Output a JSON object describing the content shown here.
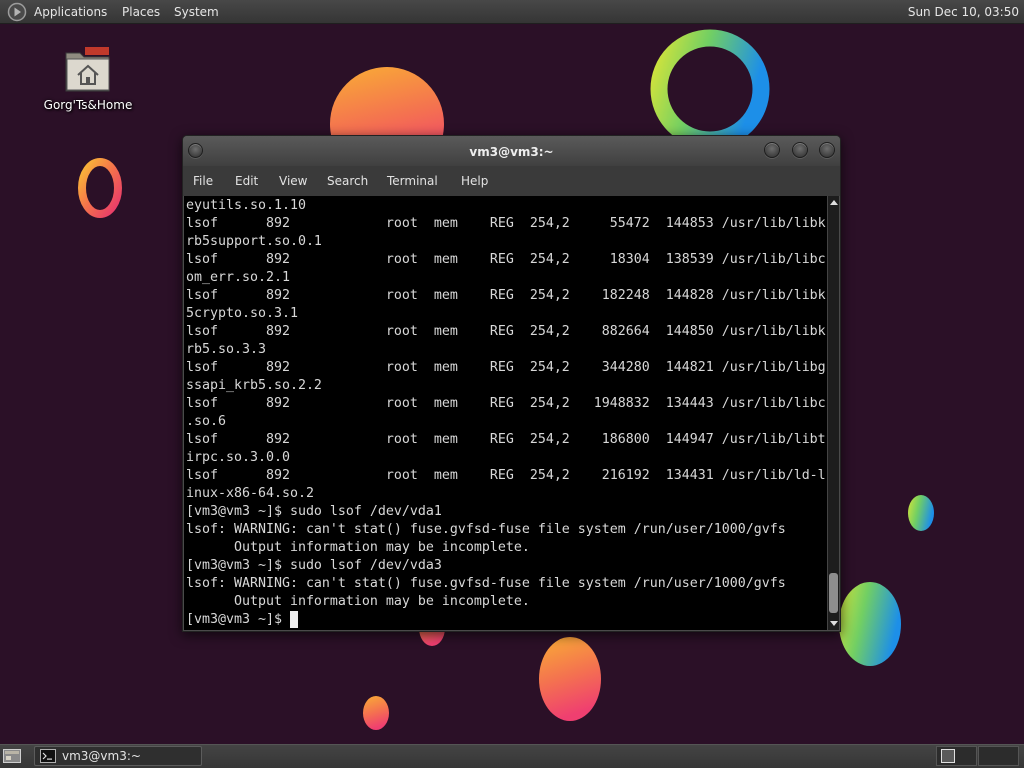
{
  "top_panel": {
    "logo_icon": "menu-logo-icon",
    "menus": {
      "applications": "Applications",
      "places": "Places",
      "system": "System"
    },
    "clock": "Sun Dec 10, 03:50"
  },
  "desktop": {
    "icon": {
      "label": "Gorg'Ts&Home",
      "icon": "home-folder-icon"
    }
  },
  "terminal": {
    "title": "vm3@vm3:~",
    "menu": [
      "File",
      "Edit",
      "View",
      "Search",
      "Terminal",
      "Help"
    ],
    "lines": [
      "eyutils.so.1.10",
      "lsof      892            root  mem    REG  254,2     55472  144853 /usr/lib/libk",
      "rb5support.so.0.1",
      "lsof      892            root  mem    REG  254,2     18304  138539 /usr/lib/libc",
      "om_err.so.2.1",
      "lsof      892            root  mem    REG  254,2    182248  144828 /usr/lib/libk",
      "5crypto.so.3.1",
      "lsof      892            root  mem    REG  254,2    882664  144850 /usr/lib/libk",
      "rb5.so.3.3",
      "lsof      892            root  mem    REG  254,2    344280  144821 /usr/lib/libg",
      "ssapi_krb5.so.2.2",
      "lsof      892            root  mem    REG  254,2   1948832  134443 /usr/lib/libc",
      ".so.6",
      "lsof      892            root  mem    REG  254,2    186800  144947 /usr/lib/libt",
      "irpc.so.3.0.0",
      "lsof      892            root  mem    REG  254,2    216192  134431 /usr/lib/ld-l",
      "inux-x86-64.so.2",
      "[vm3@vm3 ~]$ sudo lsof /dev/vda1",
      "lsof: WARNING: can't stat() fuse.gvfsd-fuse file system /run/user/1000/gvfs",
      "      Output information may be incomplete.",
      "[vm3@vm3 ~]$ sudo lsof /dev/vda3",
      "lsof: WARNING: can't stat() fuse.gvfsd-fuse file system /run/user/1000/gvfs",
      "      Output information may be incomplete."
    ],
    "prompt": "[vm3@vm3 ~]$ "
  },
  "bottom_panel": {
    "show_desktop_icon": "show-desktop-icon",
    "task": {
      "label": "vm3@vm3:~",
      "icon": "terminal-icon"
    }
  },
  "colors": {
    "desktop_bg": "#2b1027",
    "panel_bg": "#3c3c3c",
    "terminal_bg": "#000000",
    "terminal_fg": "#d8d8d8",
    "bubble_warm_start": "#f9ad35",
    "bubble_warm_end": "#ef3f70",
    "bubble_cool_start": "#d6e43a",
    "bubble_cool_end": "#1d8fe8"
  }
}
